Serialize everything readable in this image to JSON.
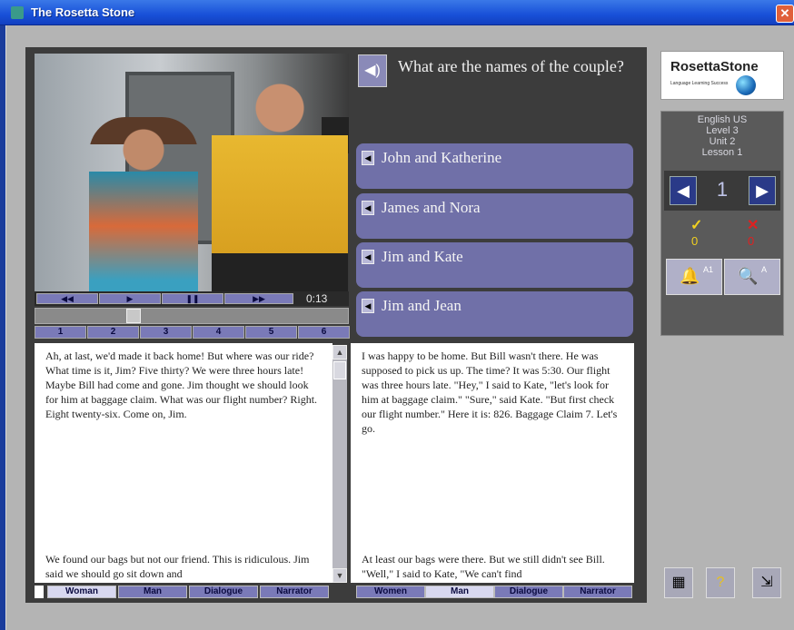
{
  "window": {
    "title": "The Rosetta Stone",
    "close_icon": "close-icon"
  },
  "video": {
    "controls": {
      "rewind": "◀◀",
      "play": "▶",
      "pause": "❚❚",
      "forward": "▶▶"
    },
    "time": "0:13",
    "segments": [
      "1",
      "2",
      "3",
      "4",
      "5",
      "6"
    ]
  },
  "question": {
    "text": "What are the names of the couple?"
  },
  "answers": [
    "John and Katherine",
    "James and Nora",
    "Jim and Kate",
    "Jim and Jean"
  ],
  "left_text": {
    "body": "Ah, at last, we'd made it back home! But where was our ride? What time is it, Jim? Five thirty? We were three hours late! Maybe Bill had come and gone. Jim thought we should look for him at baggage claim. What was our flight number? Right. Eight twenty-six. Come on, Jim.",
    "bottom": "We found our bags but not our friend. This is ridiculous. Jim said we should go sit down and"
  },
  "right_text": {
    "body": "I was happy to be home. But Bill wasn't there. He was supposed to pick us up. The time? It was 5:30. Our flight was three hours late. \"Hey,\" I said to Kate, \"let's look for him at baggage claim.\" \"Sure,\" said Kate. \"But first check our flight number.\" Here it is: 826. Baggage Claim 7. Let's go.",
    "bottom": "At least our bags were there. But we still didn't see Bill. \"Well,\" I said to Kate, \"We can't find"
  },
  "left_tabs": [
    "Woman",
    "Man",
    "Dialogue",
    "Narrator"
  ],
  "right_tabs": [
    "Women",
    "Man",
    "Dialogue",
    "Narrator"
  ],
  "logo": {
    "brand": "RosettaStone",
    "tagline": "Language Learning Success"
  },
  "course": {
    "language": "English US",
    "level": "Level 3",
    "unit": "Unit 2",
    "lesson": "Lesson 1"
  },
  "navigation": {
    "page": "1"
  },
  "score": {
    "correct": "0",
    "wrong": "0"
  },
  "tools": {
    "hint_label": "A1",
    "search_label": "A"
  },
  "colors": {
    "accent": "#7070a8",
    "window_blue": "#1850d8",
    "correct": "#f0d020",
    "wrong": "#e02020"
  }
}
